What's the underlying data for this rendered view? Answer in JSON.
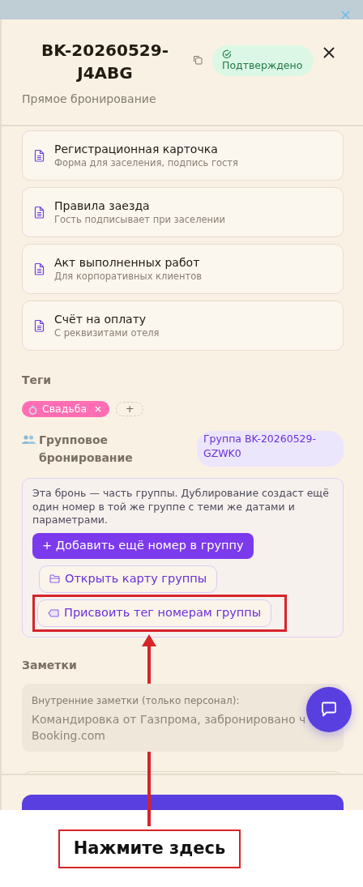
{
  "header": {
    "booking_id": "BK-20260529-J4ABG",
    "source": "Прямое бронирование",
    "status": {
      "label": "Подтверждено",
      "kind": "confirmed"
    }
  },
  "documents": [
    {
      "title": "Регистрационная карточка",
      "subtitle": "Форма для заселения, подпись гостя"
    },
    {
      "title": "Правила заезда",
      "subtitle": "Гость подписывает при заселении"
    },
    {
      "title": "Акт выполненных работ",
      "subtitle": "Для корпоративных клиентов"
    },
    {
      "title": "Счёт на оплату",
      "subtitle": "С реквизитами отеля"
    }
  ],
  "tags": {
    "title": "Теги",
    "items": [
      {
        "label": "Свадьба",
        "color": "#ff6eb4"
      }
    ],
    "add": "+"
  },
  "group": {
    "title": "Групповое бронирование",
    "badge": "Группа BK-20260529-GZWK0",
    "note": "Эта бронь — часть группы. Дублирование создаст ещё один номер в той же группе с теми же датами и параметрами.",
    "buttons": [
      {
        "label": "+ Добавить ещё номер в группу",
        "kind": "primary",
        "highlighted": false
      },
      {
        "label": "Открыть карту группы",
        "kind": "map",
        "highlighted": false
      },
      {
        "label": "Присвоить тег номерам группы",
        "kind": "tag",
        "highlighted": true
      }
    ]
  },
  "notes": {
    "title": "Заметки",
    "label": "Внутренние заметки (только персонал):",
    "lines": [
      "Командировка от Газпрома, забронировано ч",
      "Booking.com"
    ]
  },
  "annotation": {
    "label": "Нажмите здесь"
  }
}
